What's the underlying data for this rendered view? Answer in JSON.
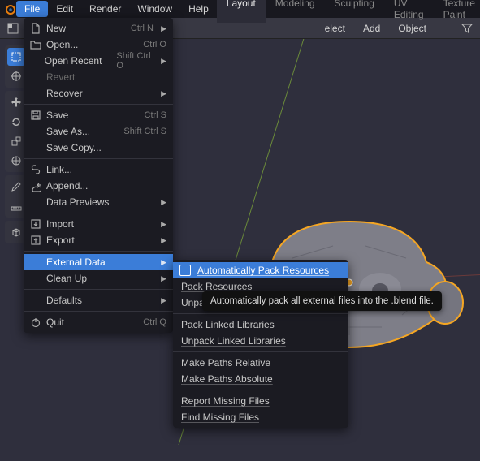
{
  "topmenu": {
    "items": [
      "File",
      "Edit",
      "Render",
      "Window",
      "Help"
    ],
    "active_index": 0
  },
  "workspace_tabs": {
    "items": [
      "Layout",
      "Modeling",
      "Sculpting",
      "UV Editing",
      "Texture Paint"
    ],
    "active_index": 0
  },
  "header": {
    "select_label": "elect",
    "add_label": "Add",
    "object_label": "Object"
  },
  "file_menu": [
    {
      "icon": "new-file-icon",
      "label": "New",
      "shortcut": "Ctrl N",
      "arrow": true
    },
    {
      "icon": "open-folder-icon",
      "label": "Open...",
      "shortcut": "Ctrl O"
    },
    {
      "icon": "",
      "label": "Open Recent",
      "shortcut": "Shift Ctrl O",
      "arrow": true
    },
    {
      "icon": "",
      "label": "Revert",
      "disabled": true
    },
    {
      "icon": "",
      "label": "Recover",
      "arrow": true
    },
    {
      "sep": true
    },
    {
      "icon": "save-icon",
      "label": "Save",
      "shortcut": "Ctrl S"
    },
    {
      "icon": "",
      "label": "Save As...",
      "shortcut": "Shift Ctrl S"
    },
    {
      "icon": "",
      "label": "Save Copy..."
    },
    {
      "sep": true
    },
    {
      "icon": "link-icon",
      "label": "Link..."
    },
    {
      "icon": "append-icon",
      "label": "Append..."
    },
    {
      "icon": "",
      "label": "Data Previews",
      "arrow": true
    },
    {
      "sep": true
    },
    {
      "icon": "import-icon",
      "label": "Import",
      "arrow": true
    },
    {
      "icon": "export-icon",
      "label": "Export",
      "arrow": true
    },
    {
      "sep": true
    },
    {
      "icon": "",
      "label": "External Data",
      "arrow": true,
      "highlight": true
    },
    {
      "icon": "",
      "label": "Clean Up",
      "arrow": true
    },
    {
      "sep": true
    },
    {
      "icon": "",
      "label": "Defaults",
      "arrow": true
    },
    {
      "sep": true
    },
    {
      "icon": "power-icon",
      "label": "Quit",
      "shortcut": "Ctrl Q"
    }
  ],
  "external_data_submenu": [
    {
      "label": "Automatically Pack Resources",
      "checkbox": true,
      "highlight": true
    },
    {
      "label": "Pack Resources"
    },
    {
      "label": "Unpack Resources",
      "obscured": true
    },
    {
      "sep": true
    },
    {
      "label": "Pack Linked Libraries"
    },
    {
      "label": "Unpack Linked Libraries"
    },
    {
      "sep": true
    },
    {
      "label": "Make Paths Relative"
    },
    {
      "label": "Make Paths Absolute"
    },
    {
      "sep": true
    },
    {
      "label": "Report Missing Files"
    },
    {
      "label": "Find Missing Files"
    }
  ],
  "tooltip": {
    "text": "Automatically pack all external files into the .blend file."
  },
  "colors": {
    "accent": "#3b7dd8",
    "selection_outline": "#f5a623"
  }
}
